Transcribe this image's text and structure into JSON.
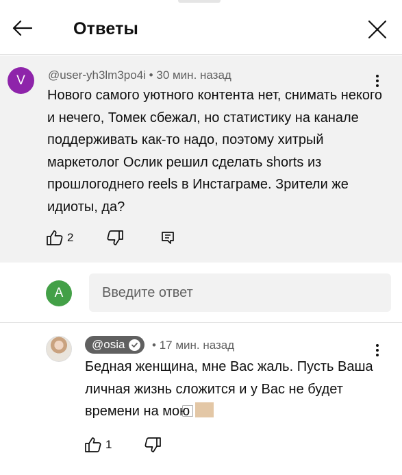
{
  "header": {
    "title": "Ответы"
  },
  "parent_comment": {
    "avatar_letter": "V",
    "author": "@user-yh3lm3po4i",
    "time": "30 мин. назад",
    "text": "Нового самого уютного контента нет, снимать некого и нечего, Томек сбежал, но статистику на канале поддерживать как-то надо, поэтому хитрый маркетолог Ослик решил сделать shorts из прошлогоднего reels в Инстаграме. Зрители же идиоты, да?",
    "likes": "2"
  },
  "reply_box": {
    "avatar_letter": "A",
    "placeholder": "Введите ответ"
  },
  "reply": {
    "author": "@osia",
    "time": "17 мин. назад",
    "text": "Бедная женщина, мне Вас жаль. Пусть Ваша личная жизнь сложится и у Вас не будет времени на мою ",
    "likes": "1"
  },
  "separators": {
    "meta_dot": "•"
  },
  "colors": {
    "avatar_v": "#8e24aa",
    "avatar_a": "#43a047",
    "chip_bg": "#606060"
  },
  "icons": [
    "back-arrow-icon",
    "close-icon",
    "more-vert-icon",
    "thumb-up-icon",
    "thumb-down-icon",
    "reply-comment-icon",
    "verified-check-icon"
  ]
}
